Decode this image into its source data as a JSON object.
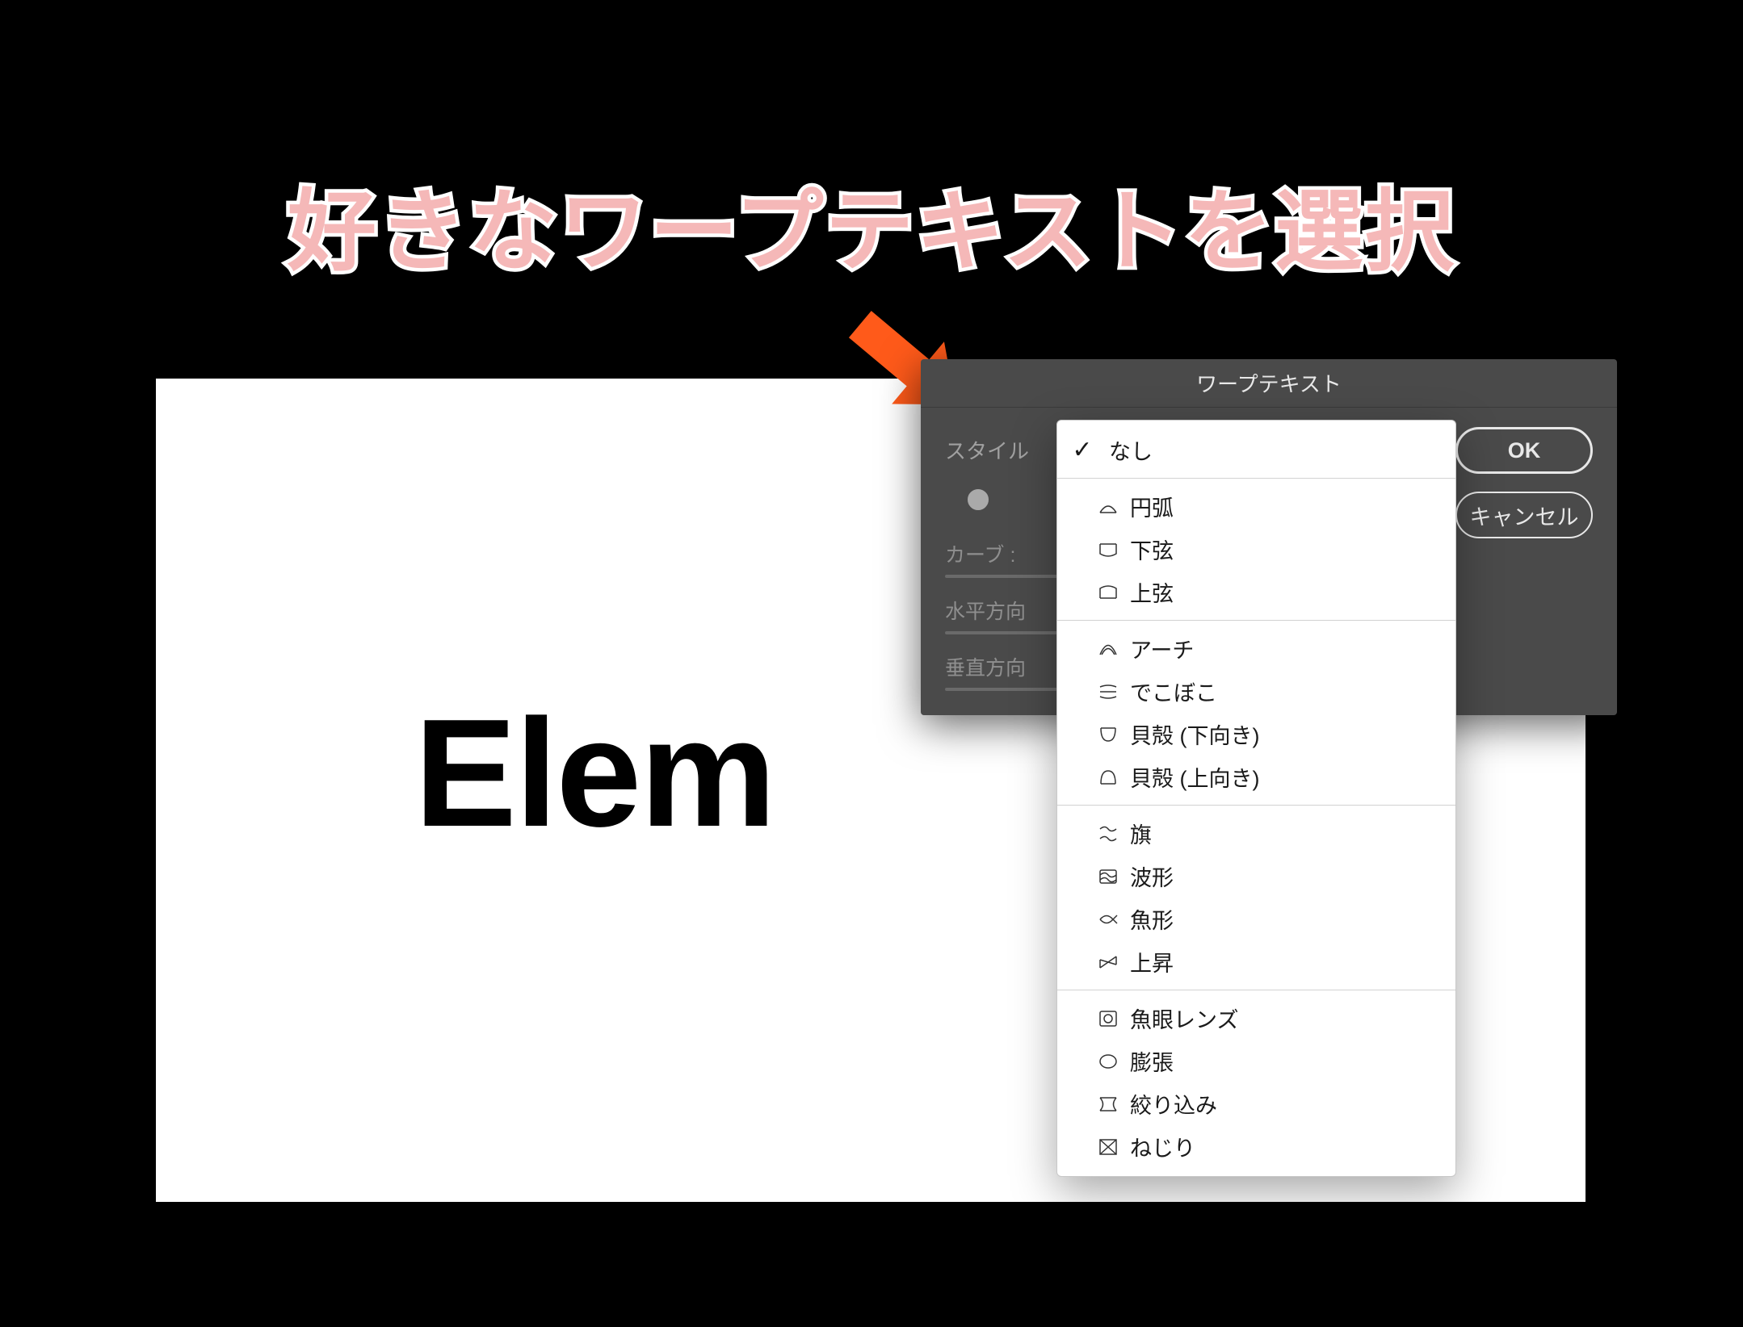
{
  "headline": "好きなワープテキストを選択",
  "canvas": {
    "text": "Elem"
  },
  "dialog": {
    "title": "ワープテキスト",
    "style_label": "スタイル",
    "curve_label": "カーブ :",
    "horiz_label": "水平方向",
    "vert_label": "垂直方向",
    "ok_label": "OK",
    "cancel_label": "キャンセル"
  },
  "dropdown": {
    "groups": [
      [
        {
          "icon": "check",
          "label": "なし",
          "selected": true,
          "icon_name": "check-icon"
        }
      ],
      [
        {
          "icon": "arc",
          "label": "円弧",
          "icon_name": "arc-icon"
        },
        {
          "icon": "arcl",
          "label": "下弦",
          "icon_name": "arc-lower-icon"
        },
        {
          "icon": "arcu",
          "label": "上弦",
          "icon_name": "arc-upper-icon"
        }
      ],
      [
        {
          "icon": "arch",
          "label": "アーチ",
          "icon_name": "arch-icon"
        },
        {
          "icon": "bulge",
          "label": "でこぼこ",
          "icon_name": "bulge-icon"
        },
        {
          "icon": "shelL",
          "label": "貝殻 (下向き)",
          "icon_name": "shell-lower-icon"
        },
        {
          "icon": "shelU",
          "label": "貝殻 (上向き)",
          "icon_name": "shell-upper-icon"
        }
      ],
      [
        {
          "icon": "flag",
          "label": "旗",
          "icon_name": "flag-icon"
        },
        {
          "icon": "wave",
          "label": "波形",
          "icon_name": "wave-icon"
        },
        {
          "icon": "fish",
          "label": "魚形",
          "icon_name": "fish-icon"
        },
        {
          "icon": "rise",
          "label": "上昇",
          "icon_name": "rise-icon"
        }
      ],
      [
        {
          "icon": "fisheye",
          "label": "魚眼レンズ",
          "icon_name": "fisheye-icon"
        },
        {
          "icon": "inflate",
          "label": "膨張",
          "icon_name": "inflate-icon"
        },
        {
          "icon": "squeeze",
          "label": "絞り込み",
          "icon_name": "squeeze-icon"
        },
        {
          "icon": "twist",
          "label": "ねじり",
          "icon_name": "twist-icon"
        }
      ]
    ]
  }
}
